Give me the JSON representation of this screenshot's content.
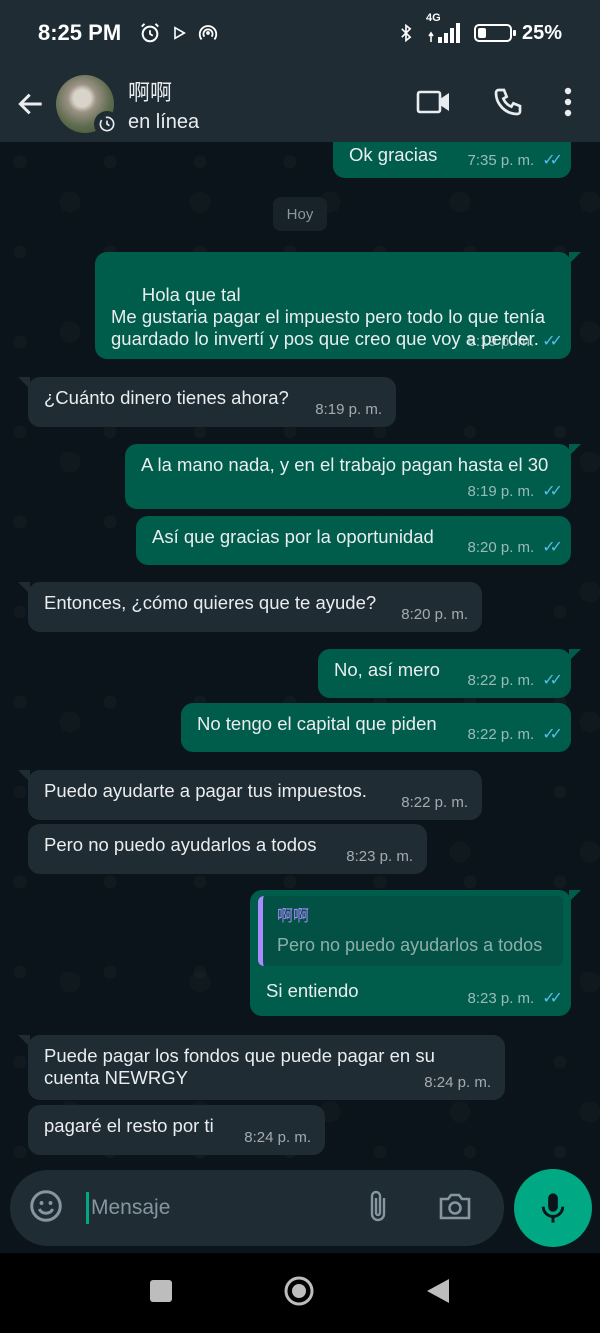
{
  "statusbar": {
    "time": "8:25 PM",
    "network": "4G",
    "battery_pct": "25%",
    "battery_level": 0.25,
    "icons": [
      "alarm-icon",
      "play-icon",
      "hotspot-icon",
      "bluetooth-icon",
      "signal-icon",
      "battery-icon"
    ]
  },
  "header": {
    "name": "啊啊",
    "status": "en línea",
    "icons": [
      "back-arrow-icon",
      "video-call-icon",
      "phone-call-icon",
      "more-options-icon"
    ]
  },
  "chat": {
    "day_separator": "Hoy",
    "messages": [
      {
        "dir": "out",
        "text": "Ok gracias",
        "time": "7:35 p. m."
      },
      {
        "dir": "out",
        "text": "Hola que tal\nMe gustaria pagar el impuesto pero todo lo que tenía guardado lo invertí y pos que creo que voy a perder.",
        "time": "8:19 p. m."
      },
      {
        "dir": "in",
        "text": "¿Cuánto dinero tienes ahora?",
        "time": "8:19 p. m."
      },
      {
        "dir": "out",
        "text": "A la mano nada, y en el trabajo pagan hasta el 30",
        "time": "8:19 p. m."
      },
      {
        "dir": "out",
        "text": "Así que gracias por la oportunidad",
        "time": "8:20 p. m."
      },
      {
        "dir": "in",
        "text": "Entonces, ¿cómo quieres que te ayude?",
        "time": "8:20 p. m."
      },
      {
        "dir": "out",
        "text": "No, así mero",
        "time": "8:22 p. m."
      },
      {
        "dir": "out",
        "text": "No tengo el capital que piden",
        "time": "8:22 p. m."
      },
      {
        "dir": "in",
        "text": "Puedo ayudarte a pagar tus impuestos.",
        "time": "8:22 p. m."
      },
      {
        "dir": "in",
        "text": "Pero no puedo ayudarlos a todos",
        "time": "8:23 p. m."
      },
      {
        "dir": "out",
        "quote_name": "啊啊",
        "quote_text": "Pero no puedo ayudarlos a todos",
        "text": "Si entiendo",
        "time": "8:23 p. m."
      },
      {
        "dir": "in",
        "text": "Puede pagar los fondos que puede pagar en su cuenta NEWRGY",
        "time": "8:24 p. m."
      },
      {
        "dir": "in",
        "text": "pagaré el resto por ti",
        "time": "8:24 p. m."
      }
    ]
  },
  "input": {
    "placeholder": "Mensaje",
    "icons": [
      "emoji-icon",
      "attach-icon",
      "camera-icon",
      "mic-icon"
    ]
  },
  "navbar": {
    "icons": [
      "recents-icon",
      "home-icon",
      "back-icon"
    ]
  },
  "colors": {
    "outgoing_bubble": "#005c4b",
    "incoming_bubble": "#202c33",
    "accent": "#00a884",
    "read_ticks": "#53bdeb",
    "header_bg": "#1f2c34",
    "chat_bg": "#0b141a"
  }
}
